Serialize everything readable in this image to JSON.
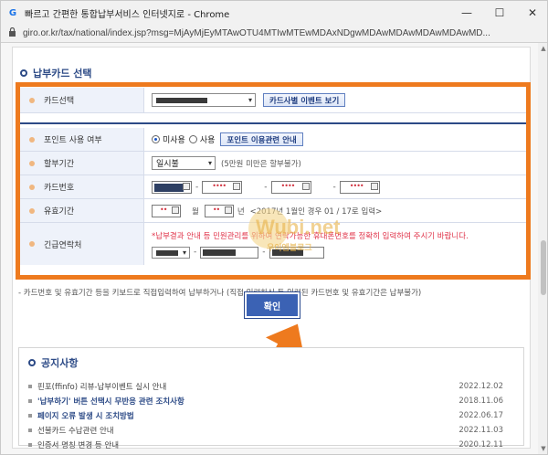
{
  "window": {
    "title": "빠르고 간편한 통합납부서비스 인터넷지로 - Chrome",
    "app_icon": "G",
    "minimize": "—",
    "maximize": "☐",
    "close": "✕"
  },
  "address": {
    "url": "giro.or.kr/tax/national/index.jsp?msg=MjAyMjEyMTAwOTU4MTIwMTEwMDAxNDgwMDAwMDAwMDAwMDAwMD..."
  },
  "section": {
    "title": "납부카드 선택"
  },
  "form": {
    "card_select": {
      "label": "카드선택",
      "button": "카드사별 이벤트 보기"
    },
    "point": {
      "label": "포인트 사용 여부",
      "option_no": "미사용",
      "option_yes": "사용",
      "selected": "미사용",
      "button": "포인트 이용관련 안내"
    },
    "installment": {
      "label": "할부기간",
      "selected": "일시불",
      "note": "(5만원 미만은 할부불가)"
    },
    "card_number": {
      "label": "카드번호",
      "masked": "••••"
    },
    "expiry": {
      "label": "유효기간",
      "masked": "••",
      "month_label": "월",
      "year_label": "년",
      "note": "<2017년 1월인 경우 01 / 17로 입력>"
    },
    "emergency_contact": {
      "label": "긴급연락처",
      "note": "*납부결과 안내 등 민원관리를 위하여 연락가능한 휴대폰번호를 정확히 입력하여 주시기 바랍니다."
    }
  },
  "footnote": "- 카드번호 및 유효기간 등을 키보드로 직접입력하여 납부하거나 (직접 입력하신 등 입력된 카드번호 및 유효기간은 납부불가)",
  "confirm_button": "확인",
  "watermark": {
    "text": "Wubi.net",
    "sub": "우이엠블로그"
  },
  "notice": {
    "title": "공지사항",
    "items": [
      {
        "text": "핀포(ffinfo) 리뷰-납부이벤트 실시 안내",
        "date": "2022.12.02",
        "bold": false
      },
      {
        "text": "'납부하기' 버튼 선택시 무반응 관련 조치사항",
        "date": "2018.11.06",
        "bold": true
      },
      {
        "text": "페이지 오류 발생 시 조치방법",
        "date": "2022.06.17",
        "bold": true
      },
      {
        "text": "선불카드 수납관련 안내",
        "date": "2022.11.03",
        "bold": false
      },
      {
        "text": "인증서 명칭 변경 등 안내",
        "date": "2020.12.11",
        "bold": false
      }
    ]
  },
  "colors": {
    "highlight_border": "#ee7a1e",
    "arrow": "#ee7a1e",
    "confirm_button": "#3b62b4",
    "section_title": "#2c4a86",
    "red_note": "#e0344a"
  }
}
